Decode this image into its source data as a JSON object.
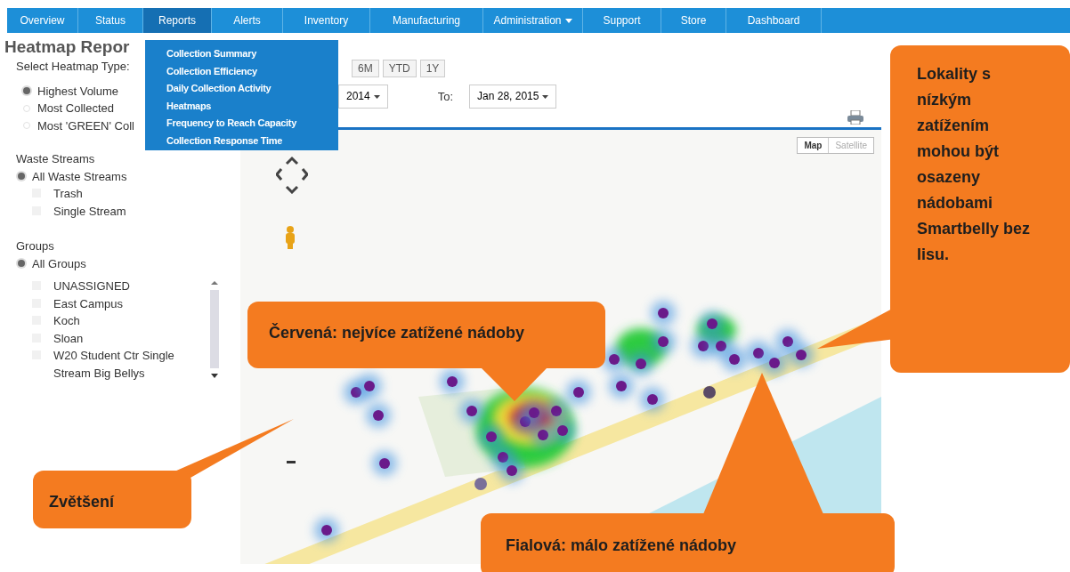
{
  "nav": [
    {
      "label": "Overview",
      "selected": false,
      "has_menu": false
    },
    {
      "label": "Status",
      "selected": false,
      "has_menu": false
    },
    {
      "label": "Reports",
      "selected": true,
      "has_menu": false
    },
    {
      "label": "Alerts",
      "selected": false,
      "has_menu": false
    },
    {
      "label": "Inventory",
      "selected": false,
      "has_menu": false
    },
    {
      "label": "Manufacturing",
      "selected": false,
      "has_menu": false
    },
    {
      "label": "Administration",
      "selected": false,
      "has_menu": true
    },
    {
      "label": "Support",
      "selected": false,
      "has_menu": false
    },
    {
      "label": "Store",
      "selected": false,
      "has_menu": false
    },
    {
      "label": "Dashboard",
      "selected": false,
      "has_menu": false
    }
  ],
  "reports_menu": [
    "Collection Summary",
    "Collection Efficiency",
    "Daily Collection Activity",
    "Heatmaps",
    "Frequency to Reach Capacity",
    "Collection Response Time"
  ],
  "page_title": "Heatmap Repor",
  "heatmap_type": {
    "label": "Select Heatmap Type:",
    "options": [
      {
        "label": "Highest Volume",
        "selected": true
      },
      {
        "label": "Most Collected",
        "selected": false
      },
      {
        "label": "Most 'GREEN' Coll",
        "selected": false
      }
    ]
  },
  "range_buttons": [
    "6M",
    "YTD",
    "1Y"
  ],
  "date_from": "2014",
  "to_label": "To:",
  "date_to": "Jan 28, 2015",
  "waste_streams": {
    "title": "Waste Streams",
    "options": [
      {
        "label": "All Waste Streams",
        "selected": true,
        "children": [
          {
            "label": "Trash",
            "selected": false
          },
          {
            "label": "Single Stream",
            "selected": false
          }
        ]
      }
    ]
  },
  "groups": {
    "title": "Groups",
    "options": [
      {
        "label": "All Groups",
        "selected": true,
        "children": [
          {
            "label": "UNASSIGNED",
            "selected": false
          },
          {
            "label": "East Campus",
            "selected": false
          },
          {
            "label": "Koch",
            "selected": false
          },
          {
            "label": "Sloan",
            "selected": false
          },
          {
            "label": "W20 Student Ctr Single Stream Big Bellys",
            "selected": false
          }
        ]
      }
    ]
  },
  "map": {
    "type_buttons": [
      {
        "label": "Map",
        "selected": true
      },
      {
        "label": "Satellite",
        "selected": false
      }
    ]
  },
  "callouts": [
    {
      "text": "Lokality s nízkým zatížením mohou být osazeny nádobami Smartbelly bez lisu."
    },
    {
      "text": "Červená: nejvíce zatížené nádoby"
    },
    {
      "text": "Zvětšení"
    },
    {
      "text": "Fialová: málo zatížené nádoby"
    }
  ]
}
